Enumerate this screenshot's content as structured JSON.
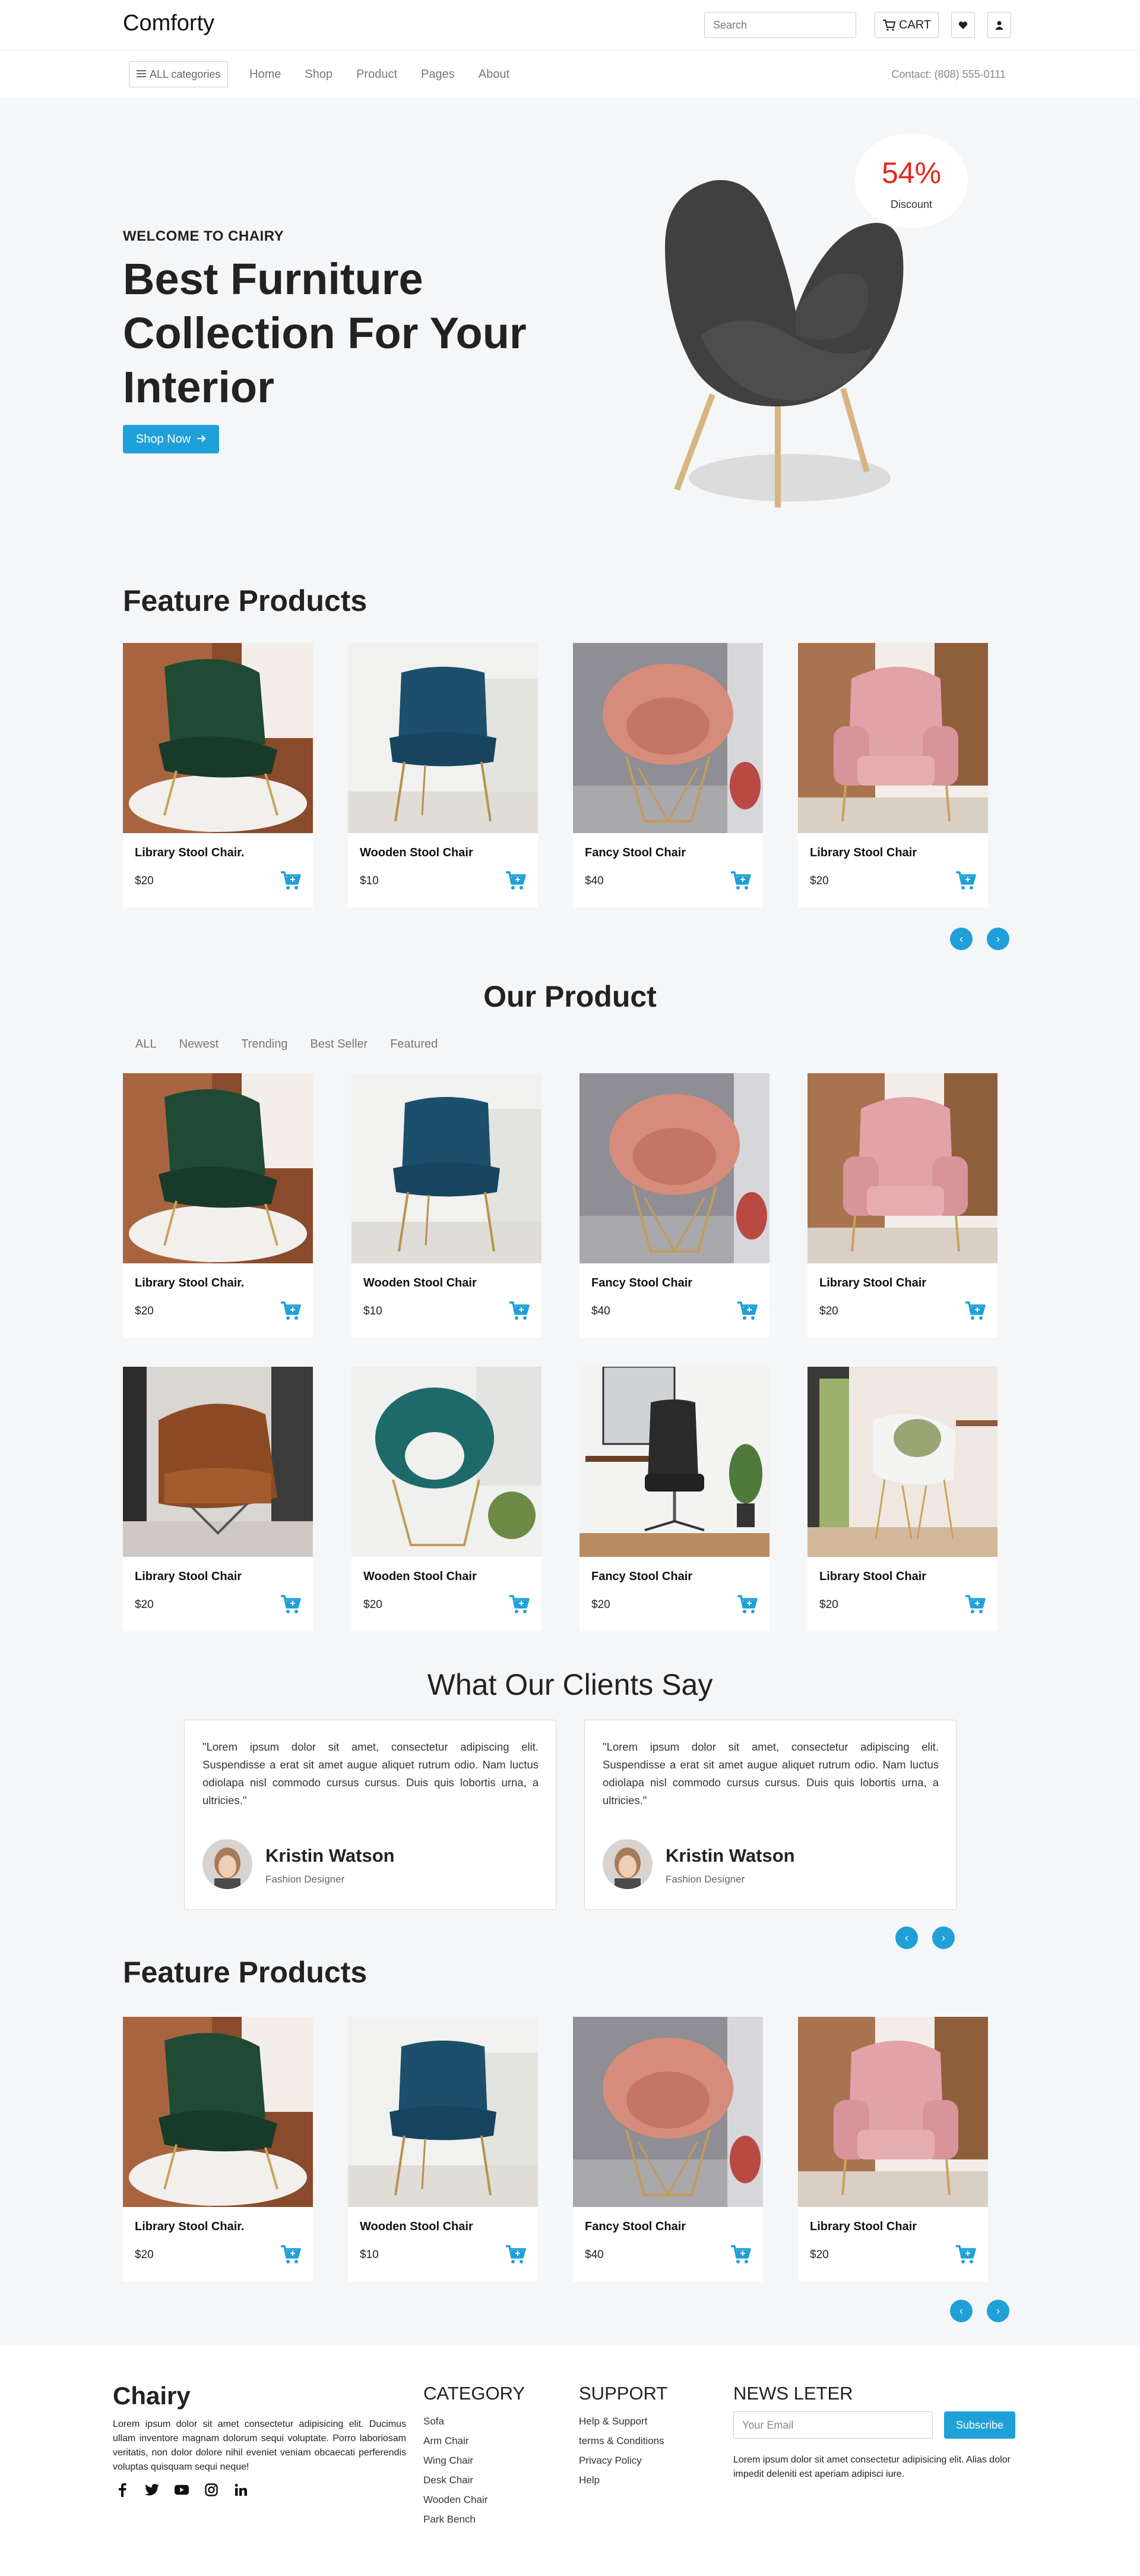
{
  "brand": {
    "name": "Comforty"
  },
  "header": {
    "search_placeholder": "Search",
    "cart_label": "CART",
    "cart_icon": "cart-icon",
    "wishlist_icon": "heart-icon",
    "user_icon": "user-icon"
  },
  "nav": {
    "categories_label": "ALL categories",
    "links": [
      "Home",
      "Shop",
      "Product",
      "Pages",
      "About"
    ],
    "contact": "Contact: (808) 555-0111"
  },
  "hero": {
    "eyebrow": "WELCOME TO CHAIRY",
    "title": "Best Furniture Collection For Your Interior",
    "button_label": "Shop Now",
    "discount_value": "54%",
    "discount_label": "Discount"
  },
  "featured": {
    "title": "Feature Products",
    "products": [
      {
        "name": "Library Stool Chair.",
        "price": "$20"
      },
      {
        "name": "Wooden Stool Chair",
        "price": "$10"
      },
      {
        "name": "Fancy Stool Chair",
        "price": "$40"
      },
      {
        "name": "Library Stool Chair",
        "price": "$20"
      }
    ]
  },
  "our_product": {
    "title": "Our Product",
    "tabs": [
      "ALL",
      "Newest",
      "Trending",
      "Best Seller",
      "Featured"
    ],
    "products": [
      {
        "name": "Library Stool Chair.",
        "price": "$20"
      },
      {
        "name": "Wooden Stool Chair",
        "price": "$10"
      },
      {
        "name": "Fancy Stool Chair",
        "price": "$40"
      },
      {
        "name": "Library Stool Chair",
        "price": "$20"
      },
      {
        "name": "Library Stool Chair",
        "price": "$20"
      },
      {
        "name": "Wooden Stool Chair",
        "price": "$20"
      },
      {
        "name": "Fancy Stool Chair",
        "price": "$20"
      },
      {
        "name": "Library Stool Chair",
        "price": "$20"
      }
    ]
  },
  "testimonials": {
    "title": "What Our Clients Say",
    "items": [
      {
        "quote": "\"Lorem ipsum dolor sit amet, consectetur adipiscing elit. Suspendisse a erat sit amet augue aliquet rutrum odio. Nam luctus odiolapa nisl commodo cursus cursus. Duis quis lobortis urna, a ultricies.\"",
        "name": "Kristin Watson",
        "role": "Fashion Designer"
      },
      {
        "quote": "\"Lorem ipsum dolor sit amet, consectetur adipiscing elit. Suspendisse a erat sit amet augue aliquet rutrum odio. Nam luctus odiolapa nisl commodo cursus cursus. Duis quis lobortis urna, a ultricies.\"",
        "name": "Kristin Watson",
        "role": "Fashion Designer"
      }
    ]
  },
  "featured2": {
    "title": "Feature Products",
    "products": [
      {
        "name": "Library Stool Chair.",
        "price": "$20"
      },
      {
        "name": "Wooden Stool Chair",
        "price": "$10"
      },
      {
        "name": "Fancy Stool Chair",
        "price": "$40"
      },
      {
        "name": "Library Stool Chair",
        "price": "$20"
      }
    ]
  },
  "footer": {
    "logo": "Chairy",
    "description": "Lorem ipsum dolor sit amet consectetur adipisicing elit. Ducimus ullam inventore magnam dolorum sequi voluptate. Porro laboriosam veritatis, non dolor dolore nihil eveniet veniam obcaecati perferendis voluptas quisquam sequi neque!",
    "social_icons": [
      "facebook-icon",
      "twitter-icon",
      "youtube-icon",
      "instagram-icon",
      "linkedin-icon"
    ],
    "category_title": "CATEGORY",
    "categories": [
      "Sofa",
      "Arm Chair",
      "Wing Chair",
      "Desk Chair",
      "Wooden Chair",
      "Park Bench"
    ],
    "support_title": "SUPPORT",
    "support_links": [
      "Help & Support",
      "terms & Conditions",
      "Privacy Policy",
      "Help"
    ],
    "newsletter_title": "NEWS LETER",
    "email_placeholder": "Your Email",
    "subscribe_label": "Subscribe",
    "newsletter_desc": "Lorem ipsum dolor sit amet consectetur adipisicing elit. Alias dolor impedit deleniti est aperiam adipisci iure."
  },
  "colors": {
    "accent": "#1fa0d8",
    "discount": "#e8261c",
    "background": "#f5f6f8"
  }
}
